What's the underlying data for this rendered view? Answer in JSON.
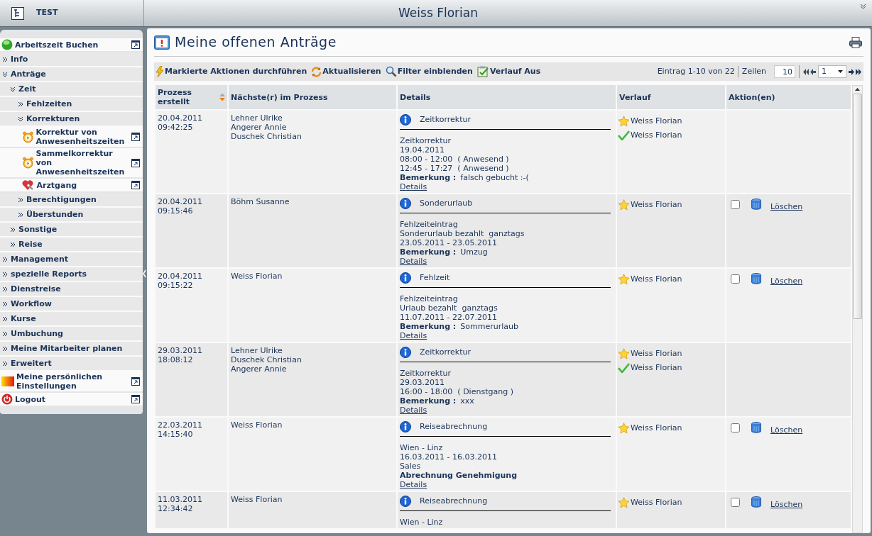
{
  "header": {
    "app_label": "TEST",
    "user": "Weiss Florian"
  },
  "sidebar": {
    "items": [
      {
        "kind": "start",
        "label": "Arbeitszeit Buchen"
      },
      {
        "kind": "folder",
        "label": "Info",
        "expanded": false
      },
      {
        "kind": "folder",
        "label": "Anträge",
        "expanded": true,
        "children": [
          {
            "kind": "folder",
            "label": "Zeit",
            "expanded": true,
            "children": [
              {
                "kind": "folder",
                "label": "Fehlzeiten",
                "expanded": false
              },
              {
                "kind": "folder",
                "label": "Korrekturen",
                "expanded": true,
                "children": [
                  {
                    "kind": "alarm",
                    "label": "Korrektur von Anwesenheitszeiten"
                  },
                  {
                    "kind": "alarm",
                    "label": "Sammelkorrektur von Anwesenheitszeiten"
                  },
                  {
                    "kind": "doctor",
                    "label": "Arztgang"
                  }
                ]
              },
              {
                "kind": "folder",
                "label": "Berechtigungen",
                "expanded": false
              },
              {
                "kind": "folder",
                "label": "Überstunden",
                "expanded": false
              }
            ]
          },
          {
            "kind": "folder",
            "label": "Sonstige",
            "expanded": false
          },
          {
            "kind": "folder",
            "label": "Reise",
            "expanded": false
          }
        ]
      },
      {
        "kind": "folder",
        "label": "Management",
        "expanded": false
      },
      {
        "kind": "folder",
        "label": "spezielle Reports",
        "expanded": false
      },
      {
        "kind": "folder",
        "label": "Dienstreise",
        "expanded": false
      },
      {
        "kind": "folder",
        "label": "Workflow",
        "expanded": false
      },
      {
        "kind": "folder",
        "label": "Kurse",
        "expanded": false
      },
      {
        "kind": "folder",
        "label": "Umbuchung",
        "expanded": false
      },
      {
        "kind": "folder",
        "label": "Meine Mitarbeiter planen",
        "expanded": false
      },
      {
        "kind": "folder",
        "label": "Erweitert",
        "expanded": false
      },
      {
        "kind": "settings",
        "label": "Meine persönlichen Einstellungen"
      },
      {
        "kind": "logout",
        "label": "Logout"
      }
    ]
  },
  "page_title": "Meine offenen Anträge",
  "toolbar": {
    "actions": [
      {
        "kind": "execute",
        "label": "Markierte Aktionen durchführen"
      },
      {
        "kind": "refresh",
        "label": "Aktualisieren"
      },
      {
        "kind": "filter",
        "label": "Filter einblenden"
      },
      {
        "kind": "history",
        "label": "Verlauf Aus"
      }
    ],
    "range": "Eintrag 1-10 von 22",
    "rows_label": "Zeilen",
    "rows_value": "10",
    "page_value": "1"
  },
  "table": {
    "columns": [
      "Prozess erstellt",
      "Nächste(r) im Prozess",
      "Details",
      "Verlauf",
      "Aktion(en)"
    ],
    "rows": [
      {
        "date": "20.04.2011",
        "time": "09:42:25",
        "next": [
          "Lehner Ulrike",
          "Angerer Annie",
          "Duschek Christian"
        ],
        "details": {
          "title": "Zeitkorrektur",
          "lines": [
            {
              "kind": "plain",
              "text": "Zeitkorrektur"
            },
            {
              "kind": "plain",
              "text": "19.04.2011"
            },
            {
              "kind": "plain",
              "text": "08:00 - 12:00  ( Anwesend )"
            },
            {
              "kind": "plain",
              "text": "12:45 - 17:27  ( Anwesend )"
            },
            {
              "kind": "remark",
              "label": "Bemerkung :",
              "text": "falsch gebucht :-("
            }
          ],
          "link": "Details"
        },
        "history": [
          {
            "kind": "pending",
            "name": "Weiss Florian"
          },
          {
            "kind": "approved",
            "name": "Weiss Florian"
          }
        ]
      },
      {
        "date": "20.04.2011",
        "time": "09:15:46",
        "next": [
          "Böhm Susanne"
        ],
        "details": {
          "title": "Sonderurlaub",
          "lines": [
            {
              "kind": "plain",
              "text": "Fehlzeiteintrag"
            },
            {
              "kind": "plain",
              "text": "Sonderurlaub bezahlt  ganztags"
            },
            {
              "kind": "plain",
              "text": "23.05.2011 - 23.05.2011"
            },
            {
              "kind": "remark",
              "label": "Bemerkung :",
              "text": "Umzug"
            }
          ],
          "link": "Details"
        },
        "history": [
          {
            "kind": "pending",
            "name": "Weiss Florian"
          }
        ],
        "action": {
          "checked": false,
          "label": "Löschen"
        }
      },
      {
        "date": "20.04.2011",
        "time": "09:15:22",
        "next": [
          "Weiss Florian"
        ],
        "details": {
          "title": "Fehlzeit",
          "lines": [
            {
              "kind": "plain",
              "text": "Fehlzeiteintrag"
            },
            {
              "kind": "plain",
              "text": "Urlaub bezahlt  ganztags"
            },
            {
              "kind": "plain",
              "text": "11.07.2011 - 22.07.2011"
            },
            {
              "kind": "remark",
              "label": "Bemerkung :",
              "text": "Sommerurlaub"
            }
          ],
          "link": "Details"
        },
        "history": [
          {
            "kind": "pending",
            "name": "Weiss Florian"
          }
        ],
        "action": {
          "checked": false,
          "label": "Löschen"
        }
      },
      {
        "date": "29.03.2011",
        "time": "18:08:12",
        "next": [
          "Lehner Ulrike",
          "Duschek Christian",
          "Angerer Annie"
        ],
        "details": {
          "title": "Zeitkorrektur",
          "lines": [
            {
              "kind": "plain",
              "text": "Zeitkorrektur"
            },
            {
              "kind": "plain",
              "text": "29.03.2011"
            },
            {
              "kind": "plain",
              "text": "16:00 - 18:00  ( Dienstgang )"
            },
            {
              "kind": "remark",
              "label": "Bemerkung :",
              "text": "xxx"
            }
          ],
          "link": "Details"
        },
        "history": [
          {
            "kind": "pending",
            "name": "Weiss Florian"
          },
          {
            "kind": "approved",
            "name": "Weiss Florian"
          }
        ]
      },
      {
        "date": "22.03.2011",
        "time": "14:15:40",
        "next": [
          "Weiss Florian"
        ],
        "details": {
          "title": "Reiseabrechnung",
          "lines": [
            {
              "kind": "plain",
              "text": "Wien - Linz"
            },
            {
              "kind": "plain",
              "text": "16.03.2011 - 16.03.2011"
            },
            {
              "kind": "plain",
              "text": "Sales"
            },
            {
              "kind": "strong",
              "text": "Abrechnung Genehmigung"
            }
          ],
          "link": "Details"
        },
        "history": [
          {
            "kind": "pending",
            "name": "Weiss Florian"
          }
        ],
        "action": {
          "checked": false,
          "label": "Löschen"
        }
      },
      {
        "date": "11.03.2011",
        "time": "12:34:42",
        "next": [
          "Weiss Florian"
        ],
        "details": {
          "title": "Reiseabrechnung",
          "lines": [
            {
              "kind": "plain",
              "text": "Wien - Linz"
            }
          ]
        },
        "history": [
          {
            "kind": "pending",
            "name": "Weiss Florian"
          }
        ],
        "action": {
          "checked": false,
          "label": "Löschen"
        }
      }
    ]
  }
}
